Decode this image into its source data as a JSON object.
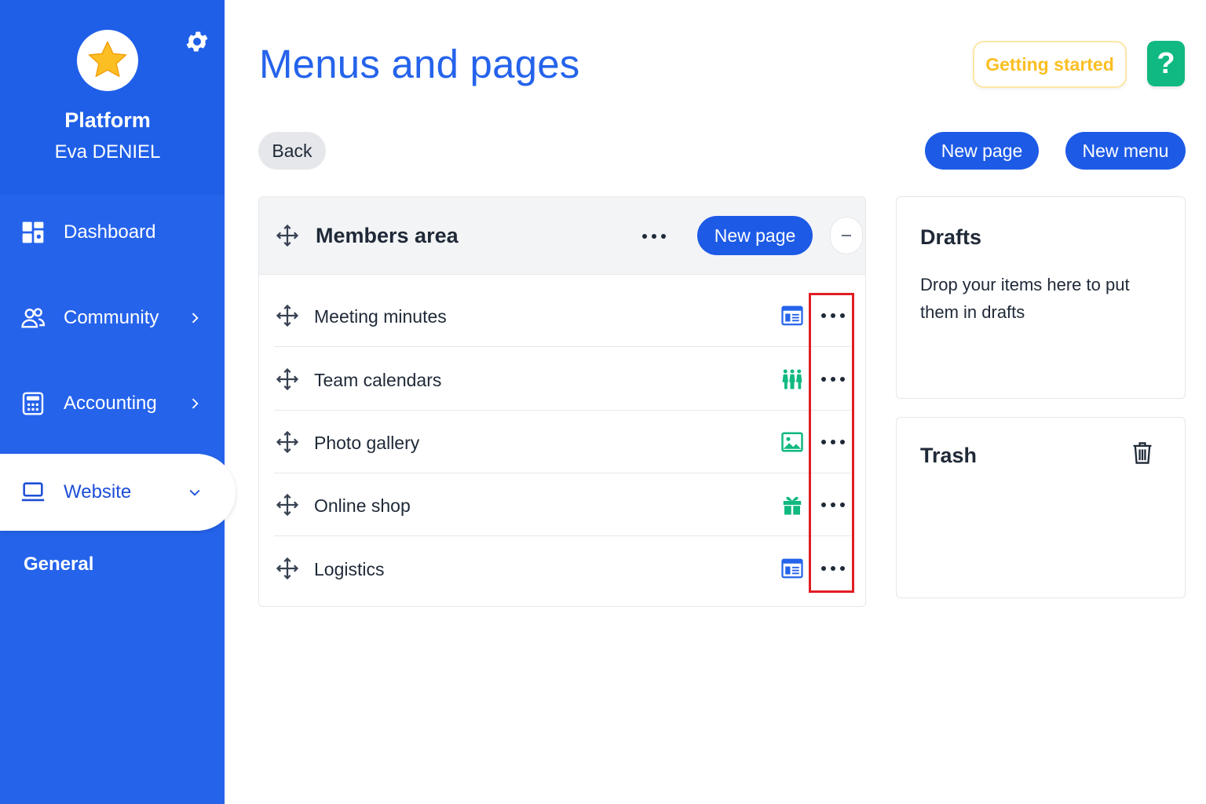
{
  "app": {
    "brand_name": "Platform",
    "user_name": "Eva DENIEL",
    "logo_icon": "star-icon",
    "settings_icon": "gear-icon"
  },
  "sidebar": {
    "items": [
      {
        "label": "Dashboard",
        "icon": "dashboard-icon"
      },
      {
        "label": "Community",
        "icon": "users-icon"
      },
      {
        "label": "Accounting",
        "icon": "calculator-icon"
      },
      {
        "label": "Website",
        "icon": "laptop-icon",
        "active": true
      }
    ],
    "sub_items": [
      {
        "label": "General"
      }
    ]
  },
  "header": {
    "title": "Menus and pages",
    "getting_started": "Getting started",
    "help": "?"
  },
  "toolbar": {
    "back": "Back",
    "new_page": "New page",
    "new_menu": "New menu"
  },
  "menu": {
    "title": "Members area",
    "new_page": "New page",
    "pages": [
      {
        "label": "Meeting minutes",
        "icon": "page-layout-icon"
      },
      {
        "label": "Team calendars",
        "icon": "people-icon"
      },
      {
        "label": "Photo gallery",
        "icon": "image-icon"
      },
      {
        "label": "Online shop",
        "icon": "gift-icon"
      },
      {
        "label": "Logistics",
        "icon": "page-layout-icon"
      }
    ]
  },
  "drafts": {
    "title": "Drafts",
    "text": "Drop your items here to put them in drafts"
  },
  "trash": {
    "title": "Trash"
  },
  "colors": {
    "sidebar": "#2563eb",
    "primary": "#1d5ae6",
    "accent_yellow": "#fbbf24",
    "help_green": "#10b981",
    "highlight_red": "#e11d24",
    "icon_green": "#10b981"
  }
}
